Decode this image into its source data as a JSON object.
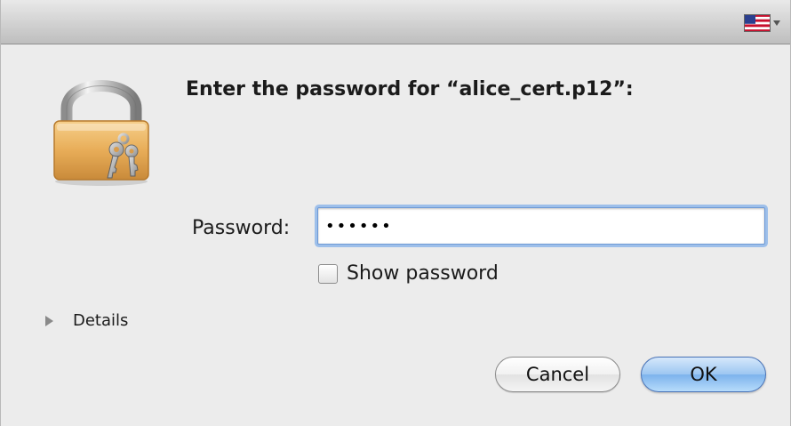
{
  "dialog": {
    "prompt": "Enter the password for “alice_cert.p12”:",
    "password_label": "Password:",
    "password_value": "••••••",
    "show_password_label": "Show password",
    "show_password_checked": false,
    "details_label": "Details",
    "cancel_label": "Cancel",
    "ok_label": "OK"
  },
  "titlebar": {
    "input_menu_icon": "us-flag-icon"
  },
  "icons": {
    "lock": "padlock-with-keys-icon",
    "disclosure": "disclosure-triangle-icon"
  },
  "colors": {
    "window_bg": "#ececec",
    "focus_ring": "#9dbfea",
    "default_button": "#7cb2ec"
  }
}
